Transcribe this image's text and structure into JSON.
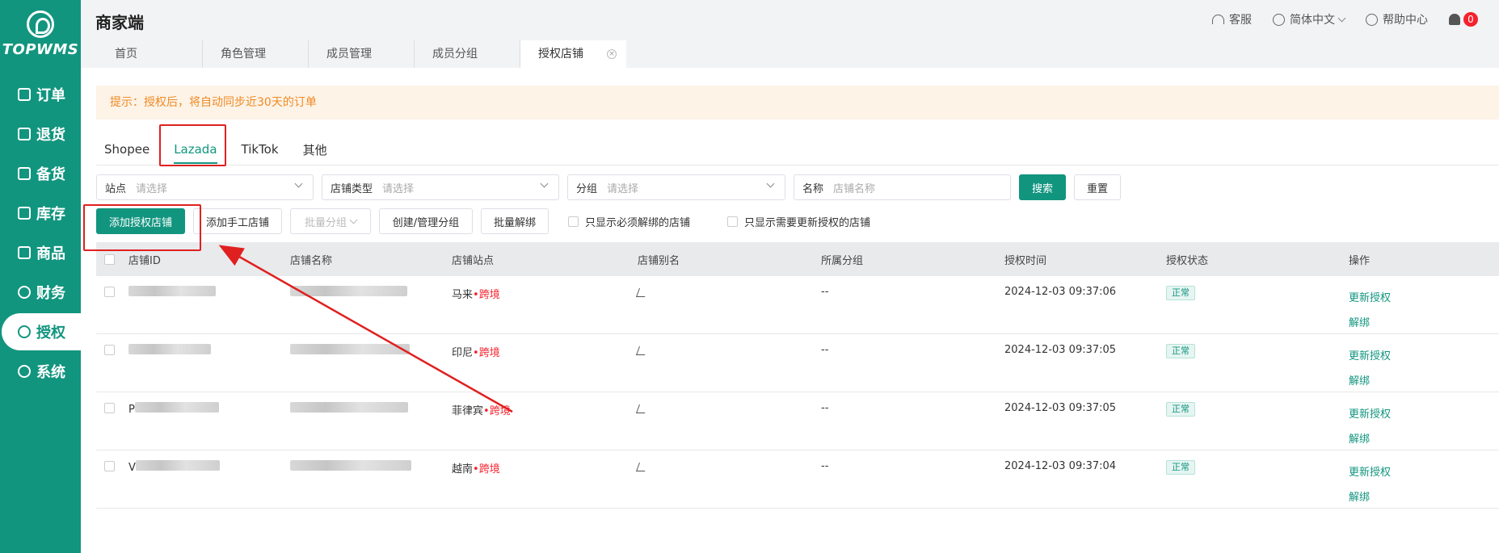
{
  "sidebar": {
    "logo_text": "TOPWMS",
    "items": [
      {
        "label": "订单",
        "icon": "list-icon"
      },
      {
        "label": "退货",
        "icon": "return-icon"
      },
      {
        "label": "备货",
        "icon": "box-icon"
      },
      {
        "label": "库存",
        "icon": "inventory-icon"
      },
      {
        "label": "商品",
        "icon": "bag-icon"
      },
      {
        "label": "财务",
        "icon": "finance-icon"
      },
      {
        "label": "授权",
        "icon": "authorize-icon",
        "active": true
      },
      {
        "label": "系统",
        "icon": "gear-icon"
      }
    ]
  },
  "header": {
    "title": "商家端",
    "service": "客服",
    "language": "简体中文",
    "help": "帮助中心",
    "notifications": "0"
  },
  "page_tabs": [
    "首页",
    "角色管理",
    "成员管理",
    "成员分组",
    "授权店铺"
  ],
  "notice": "提示：授权后，将自动同步近30天的订单",
  "platform_tabs": [
    "Shopee",
    "Lazada",
    "TikTok",
    "其他"
  ],
  "filters": {
    "site_label": "站点",
    "site_placeholder": "请选择",
    "type_label": "店铺类型",
    "type_placeholder": "请选择",
    "group_label": "分组",
    "group_placeholder": "请选择",
    "name_label": "名称",
    "name_placeholder": "店铺名称",
    "search": "搜索",
    "reset": "重置"
  },
  "actions": {
    "add_auth": "添加授权店铺",
    "add_manual": "添加手工店铺",
    "batch_group": "批量分组",
    "manage_group": "创建/管理分组",
    "batch_unbind": "批量解绑",
    "only_must_unbind": "只显示必须解绑的店铺",
    "only_need_update": "只显示需要更新授权的店铺"
  },
  "table": {
    "columns": [
      "店铺ID",
      "店铺名称",
      "店铺站点",
      "店铺别名",
      "所属分组",
      "授权时间",
      "授权状态",
      "操作"
    ],
    "rows": [
      {
        "id_prefix": "",
        "site": "马来",
        "tag": "跨境",
        "group": "--",
        "time": "2024-12-03 09:37:06",
        "status": "正常"
      },
      {
        "id_prefix": "",
        "site": "印尼",
        "tag": "跨境",
        "group": "--",
        "time": "2024-12-03 09:37:05",
        "status": "正常"
      },
      {
        "id_prefix": "P",
        "site": "菲律宾",
        "tag": "跨境",
        "group": "--",
        "time": "2024-12-03 09:37:05",
        "status": "正常"
      },
      {
        "id_prefix": "V",
        "site": "越南",
        "tag": "跨境",
        "group": "--",
        "time": "2024-12-03 09:37:04",
        "status": "正常"
      }
    ],
    "op_update": "更新授权",
    "op_unbind": "解绑"
  },
  "colors": {
    "brand": "#12957f",
    "annotation": "#e02020",
    "notice_text": "#f08a24",
    "cross_border": "#f5222d"
  }
}
